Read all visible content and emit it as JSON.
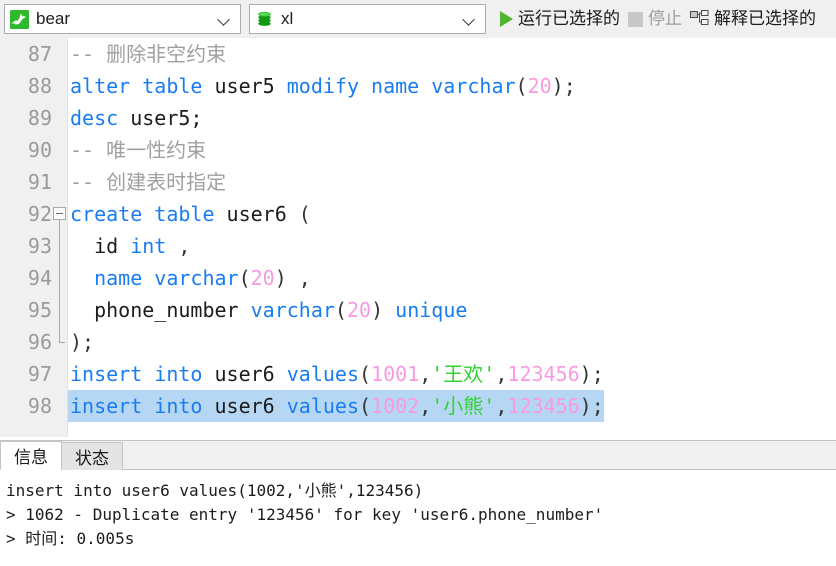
{
  "toolbar": {
    "connection": {
      "value": "bear",
      "icon": "mysql-connection-icon",
      "caret_icon": "chevron-down-icon"
    },
    "database": {
      "value": "xl",
      "icon": "database-icon",
      "caret_icon": "chevron-down-icon"
    },
    "buttons": [
      {
        "label": "运行已选择的",
        "icon": "play-icon",
        "enabled": true
      },
      {
        "label": "停止",
        "icon": "stop-square-icon",
        "enabled": false
      },
      {
        "label": "解释已选择的",
        "icon": "explain-plan-icon",
        "enabled": true
      }
    ]
  },
  "editor": {
    "first_line_number": 87,
    "selected_line_number": 98,
    "fold_start_line": 92,
    "fold_end_line": 96,
    "lines": [
      {
        "n": "87",
        "tokens": [
          {
            "t": "-- 删除非空约束",
            "c": "cmt"
          }
        ]
      },
      {
        "n": "88",
        "tokens": [
          {
            "t": "alter table ",
            "c": "kw"
          },
          {
            "t": "user5 ",
            "c": "id"
          },
          {
            "t": "modify name varchar",
            "c": "kw"
          },
          {
            "t": "(",
            "c": "pun"
          },
          {
            "t": "20",
            "c": "num"
          },
          {
            "t": ");",
            "c": "pun"
          }
        ]
      },
      {
        "n": "89",
        "tokens": [
          {
            "t": "desc ",
            "c": "kw"
          },
          {
            "t": "user5;",
            "c": "id"
          }
        ]
      },
      {
        "n": "90",
        "tokens": [
          {
            "t": "-- 唯一性约束",
            "c": "cmt"
          }
        ]
      },
      {
        "n": "91",
        "tokens": [
          {
            "t": "-- 创建表时指定",
            "c": "cmt"
          }
        ]
      },
      {
        "n": "92",
        "tokens": [
          {
            "t": "create table ",
            "c": "kw"
          },
          {
            "t": "user6 ",
            "c": "id"
          },
          {
            "t": "(",
            "c": "pun"
          }
        ]
      },
      {
        "n": "93",
        "tokens": [
          {
            "t": "  id ",
            "c": "id"
          },
          {
            "t": "int ",
            "c": "kw"
          },
          {
            "t": ",",
            "c": "pun"
          }
        ]
      },
      {
        "n": "94",
        "tokens": [
          {
            "t": "  name varchar",
            "c": "kw"
          },
          {
            "t": "(",
            "c": "pun"
          },
          {
            "t": "20",
            "c": "num"
          },
          {
            "t": ") ,",
            "c": "pun"
          }
        ]
      },
      {
        "n": "95",
        "tokens": [
          {
            "t": "  phone_number ",
            "c": "id"
          },
          {
            "t": "varchar",
            "c": "kw"
          },
          {
            "t": "(",
            "c": "pun"
          },
          {
            "t": "20",
            "c": "num"
          },
          {
            "t": ") ",
            "c": "pun"
          },
          {
            "t": "unique",
            "c": "kw"
          }
        ]
      },
      {
        "n": "96",
        "tokens": [
          {
            "t": ");",
            "c": "pun"
          }
        ]
      },
      {
        "n": "97",
        "tokens": [
          {
            "t": "insert into ",
            "c": "kw"
          },
          {
            "t": "user6 ",
            "c": "id"
          },
          {
            "t": "values",
            "c": "kw"
          },
          {
            "t": "(",
            "c": "pun"
          },
          {
            "t": "1001",
            "c": "num"
          },
          {
            "t": ",",
            "c": "pun"
          },
          {
            "t": "'王欢'",
            "c": "str"
          },
          {
            "t": ",",
            "c": "pun"
          },
          {
            "t": "123456",
            "c": "num"
          },
          {
            "t": ");",
            "c": "pun"
          }
        ]
      },
      {
        "n": "98",
        "selected": true,
        "tokens": [
          {
            "t": "insert into ",
            "c": "kw"
          },
          {
            "t": "user6 ",
            "c": "id"
          },
          {
            "t": "values",
            "c": "kw"
          },
          {
            "t": "(",
            "c": "pun"
          },
          {
            "t": "1002",
            "c": "num"
          },
          {
            "t": ",",
            "c": "pun"
          },
          {
            "t": "'小熊'",
            "c": "str"
          },
          {
            "t": ",",
            "c": "pun"
          },
          {
            "t": "123456",
            "c": "num"
          },
          {
            "t": ");",
            "c": "pun"
          }
        ]
      }
    ]
  },
  "result_panel": {
    "tabs": [
      {
        "label": "信息",
        "active": true
      },
      {
        "label": "状态",
        "active": false
      }
    ],
    "output_lines": [
      "insert into user6 values(1002,'小熊',123456)",
      "> 1062 - Duplicate entry '123456' for key 'user6.phone_number'",
      "> 时间: 0.005s"
    ]
  },
  "colors": {
    "toolbar_bg": "#f0f0f0",
    "editor_bg": "#ffffff",
    "gutter_bg": "#f0f0f0",
    "line_number": "#9a9a9a",
    "keyword": "#1a7cf0",
    "identifier": "#1c1c1c",
    "number": "#f79ae0",
    "string": "#2fd32f",
    "comment": "#a0a0a0",
    "selection": "#b6d7f4",
    "run_icon": "#53b332",
    "connection_icon": "#2eb82e",
    "database_icon": "#129912"
  }
}
